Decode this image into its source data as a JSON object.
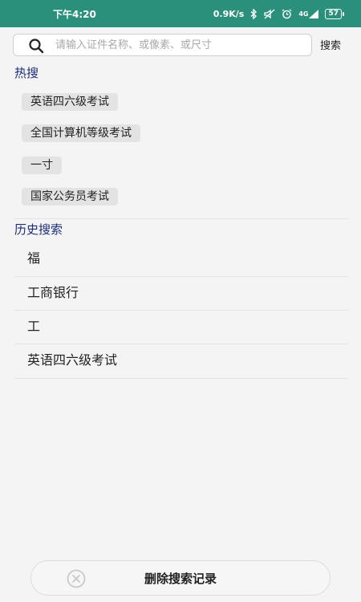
{
  "status_bar": {
    "time": "下午4:20",
    "network_speed": "0.9K/s",
    "signal": "4G",
    "battery": "57",
    "icons": [
      "bluetooth-icon",
      "mute-icon",
      "alarm-icon",
      "signal-icon",
      "battery-icon"
    ]
  },
  "search": {
    "placeholder": "请输入证件名称、或像素、或尺寸",
    "button_label": "搜索"
  },
  "hot": {
    "title": "热搜",
    "items": [
      "英语四六级考试",
      "全国计算机等级考试",
      "一寸",
      "国家公务员考试"
    ]
  },
  "history": {
    "title": "历史搜索",
    "items": [
      "福",
      "工商银行",
      "工",
      "英语四六级考试"
    ]
  },
  "bottom": {
    "clear_label": "删除搜索记录"
  },
  "colors": {
    "status_bar": "#2a8f7b",
    "section_title": "#1c2d7a"
  }
}
